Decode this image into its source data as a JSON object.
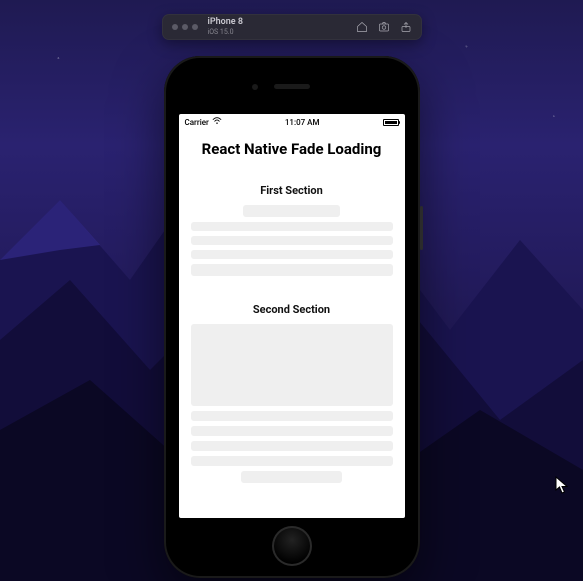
{
  "toolbar": {
    "device_name": "iPhone 8",
    "os_version": "iOS 15.0"
  },
  "statusbar": {
    "carrier": "Carrier",
    "time": "11:07 AM"
  },
  "app": {
    "title": "React Native Fade Loading",
    "section1_title": "First Section",
    "section2_title": "Second Section"
  },
  "colors": {
    "skeleton": "#efefef",
    "toolbar_bg": "#2a2935",
    "wallpaper_top": "#2a2270",
    "wallpaper_bottom": "#120e2e"
  }
}
